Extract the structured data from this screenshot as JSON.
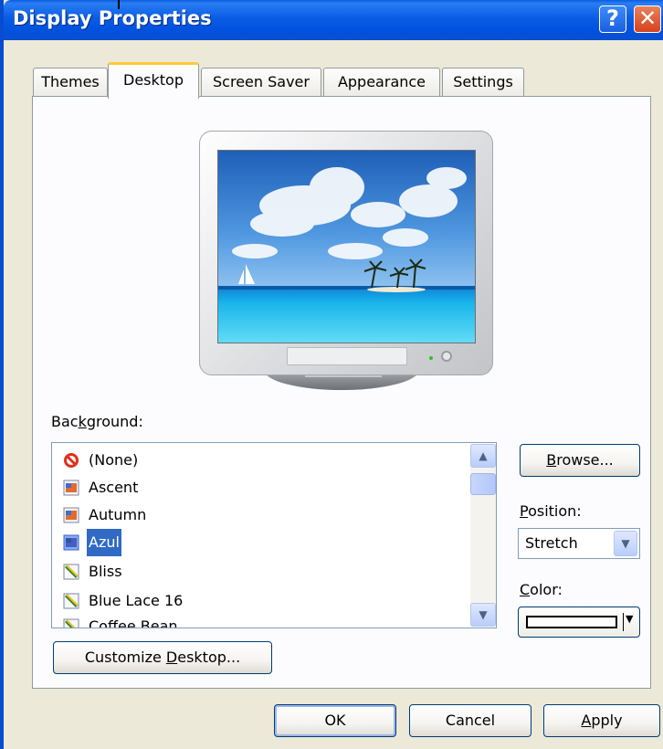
{
  "window": {
    "title": "Display Properties"
  },
  "tabs": [
    {
      "label": "Themes",
      "active": false
    },
    {
      "label": "Desktop",
      "active": true
    },
    {
      "label": "Screen Saver",
      "active": false
    },
    {
      "label": "Appearance",
      "active": false
    },
    {
      "label": "Settings",
      "active": false
    }
  ],
  "background": {
    "label_pre": "Bac",
    "label_key": "k",
    "label_post": "ground:",
    "items": [
      {
        "label": "(None)",
        "icon": "none-icon"
      },
      {
        "label": "Ascent",
        "icon": "image-file-icon"
      },
      {
        "label": "Autumn",
        "icon": "image-file-icon"
      },
      {
        "label": "Azul",
        "icon": "image-file-icon",
        "selected": true
      },
      {
        "label": "Bliss",
        "icon": "bitmap-file-icon"
      },
      {
        "label": "Blue Lace 16",
        "icon": "bitmap-file-icon"
      },
      {
        "label": "Coffee Bean",
        "icon": "bitmap-file-icon"
      }
    ]
  },
  "browse": {
    "key": "B",
    "rest": "rowse..."
  },
  "position": {
    "label_key": "P",
    "label_rest": "osition:",
    "value": "Stretch"
  },
  "color": {
    "label_key": "C",
    "label_rest": "olor:",
    "value": "#ffffff"
  },
  "customize": {
    "pre": "Customize ",
    "key": "D",
    "rest": "esktop..."
  },
  "footer": {
    "ok": "OK",
    "cancel": "Cancel",
    "apply_key": "A",
    "apply_rest": "pply"
  },
  "colors": {
    "title_bar": "#0a5ce5",
    "selection": "#316ac5",
    "active_tab_accent": "#ffc83c"
  }
}
